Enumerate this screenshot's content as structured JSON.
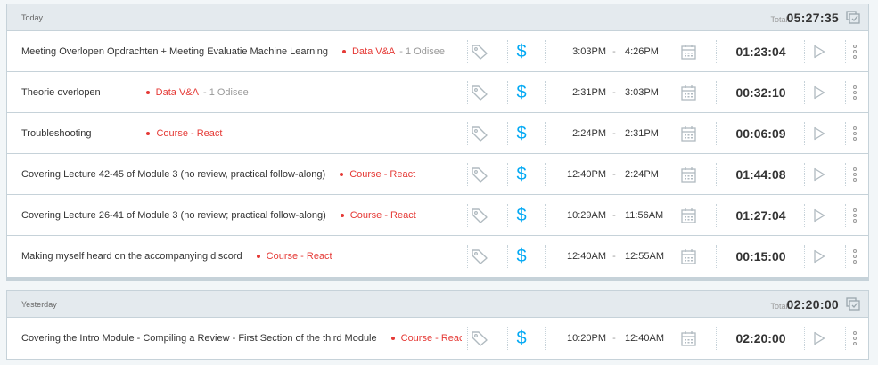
{
  "colors": {
    "project_red": "#e53935",
    "billable_blue": "#03a9f4",
    "header_bg": "#e4eaee",
    "border": "#c6d2d9"
  },
  "icons": {
    "tag": "tag-icon",
    "billable": "dollar-icon",
    "calendar": "calendar-icon",
    "play": "play-icon",
    "more": "more-vertical-icon",
    "bulk_edit": "bulk-edit-icon"
  },
  "billable_symbol": "$",
  "time_separator": "-",
  "total_label": "Total:",
  "days": [
    {
      "label": "Today",
      "total": "05:27:35",
      "entries": [
        {
          "description": "Meeting Overlopen Opdrachten + Meeting Evaluatie Machine Learning",
          "project": "Data V&A",
          "client": "- 1 Odisee",
          "start": "3:03PM",
          "end": "4:26PM",
          "duration": "01:23:04"
        },
        {
          "description": "Theorie overlopen",
          "project": "Data V&A",
          "client": "- 1 Odisee",
          "start": "2:31PM",
          "end": "3:03PM",
          "duration": "00:32:10"
        },
        {
          "description": "Troubleshooting",
          "project": "Course - React",
          "client": "",
          "start": "2:24PM",
          "end": "2:31PM",
          "duration": "00:06:09"
        },
        {
          "description": "Covering Lecture 42-45 of Module 3 (no review, practical follow-along)",
          "project": "Course - React",
          "client": "",
          "start": "12:40PM",
          "end": "2:24PM",
          "duration": "01:44:08"
        },
        {
          "description": "Covering Lecture 26-41 of Module 3 (no review; practical follow-along)",
          "project": "Course - React",
          "client": "",
          "start": "10:29AM",
          "end": "11:56AM",
          "duration": "01:27:04"
        },
        {
          "description": "Making myself heard on the accompanying discord",
          "project": "Course - React",
          "client": "",
          "start": "12:40AM",
          "end": "12:55AM",
          "duration": "00:15:00"
        }
      ]
    },
    {
      "label": "Yesterday",
      "total": "02:20:00",
      "entries": [
        {
          "description": "Covering the Intro Module - Compiling a Review - First Section of the third Module",
          "project": "Course - React",
          "client": "",
          "start": "10:20PM",
          "end": "12:40AM",
          "duration": "02:20:00"
        }
      ]
    }
  ]
}
